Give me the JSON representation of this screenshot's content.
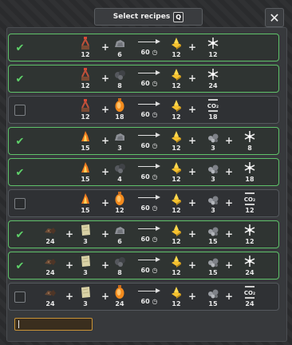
{
  "header": {
    "title": "Select recipes",
    "hotkey": "Q",
    "close_glyph": "✕"
  },
  "symbols": {
    "check": "✔",
    "plus": "+",
    "clock_glyph": "◷"
  },
  "search": {
    "value": ""
  },
  "recipes": [
    {
      "selected": true,
      "inputs": [
        {
          "icon": "crane-icon",
          "qty": "12"
        },
        {
          "icon": "stone-icon",
          "qty": "6"
        }
      ],
      "time": "60",
      "outputs": [
        {
          "icon": "gold-ingot-icon",
          "qty": "12"
        },
        {
          "icon": "snowflake-icon",
          "qty": "12"
        }
      ]
    },
    {
      "selected": true,
      "inputs": [
        {
          "icon": "crane-icon",
          "qty": "12"
        },
        {
          "icon": "coal-icon",
          "qty": "8"
        }
      ],
      "time": "60",
      "outputs": [
        {
          "icon": "gold-ingot-icon",
          "qty": "12"
        },
        {
          "icon": "snowflake-icon",
          "qty": "24"
        }
      ]
    },
    {
      "selected": false,
      "inputs": [
        {
          "icon": "crane-icon",
          "qty": "12"
        },
        {
          "icon": "gas-canister-icon",
          "qty": "18"
        }
      ],
      "time": "60",
      "outputs": [
        {
          "icon": "gold-ingot-icon",
          "qty": "12"
        },
        {
          "icon": "co2-icon",
          "qty": "18"
        }
      ]
    },
    {
      "selected": true,
      "inputs": [
        {
          "icon": "molten-metal-icon",
          "qty": "15"
        },
        {
          "icon": "stone-icon",
          "qty": "3"
        }
      ],
      "time": "60",
      "outputs": [
        {
          "icon": "gold-ingot-icon",
          "qty": "12"
        },
        {
          "icon": "gravel-icon",
          "qty": "3"
        },
        {
          "icon": "snowflake-icon",
          "qty": "8"
        }
      ]
    },
    {
      "selected": true,
      "inputs": [
        {
          "icon": "molten-metal-icon",
          "qty": "15"
        },
        {
          "icon": "coal-icon",
          "qty": "4"
        }
      ],
      "time": "60",
      "outputs": [
        {
          "icon": "gold-ingot-icon",
          "qty": "12"
        },
        {
          "icon": "gravel-icon",
          "qty": "3"
        },
        {
          "icon": "snowflake-icon",
          "qty": "18"
        }
      ]
    },
    {
      "selected": false,
      "inputs": [
        {
          "icon": "molten-metal-icon",
          "qty": "15"
        },
        {
          "icon": "gas-canister-icon",
          "qty": "12"
        }
      ],
      "time": "60",
      "outputs": [
        {
          "icon": "gold-ingot-icon",
          "qty": "12"
        },
        {
          "icon": "gravel-icon",
          "qty": "3"
        },
        {
          "icon": "co2-icon",
          "qty": "12"
        }
      ]
    },
    {
      "selected": true,
      "inputs": [
        {
          "icon": "ore-chunks-icon",
          "qty": "24"
        },
        {
          "icon": "limestone-icon",
          "qty": "3"
        },
        {
          "icon": "stone-icon",
          "qty": "6"
        }
      ],
      "time": "60",
      "outputs": [
        {
          "icon": "gold-ingot-icon",
          "qty": "12"
        },
        {
          "icon": "gravel-icon",
          "qty": "15"
        },
        {
          "icon": "snowflake-icon",
          "qty": "12"
        }
      ]
    },
    {
      "selected": true,
      "inputs": [
        {
          "icon": "ore-chunks-icon",
          "qty": "24"
        },
        {
          "icon": "limestone-icon",
          "qty": "3"
        },
        {
          "icon": "coal-icon",
          "qty": "8"
        }
      ],
      "time": "60",
      "outputs": [
        {
          "icon": "gold-ingot-icon",
          "qty": "12"
        },
        {
          "icon": "gravel-icon",
          "qty": "15"
        },
        {
          "icon": "snowflake-icon",
          "qty": "24"
        }
      ]
    },
    {
      "selected": false,
      "inputs": [
        {
          "icon": "ore-chunks-icon",
          "qty": "24"
        },
        {
          "icon": "limestone-icon",
          "qty": "3"
        },
        {
          "icon": "gas-canister-icon",
          "qty": "24"
        }
      ],
      "time": "60",
      "outputs": [
        {
          "icon": "gold-ingot-icon",
          "qty": "12"
        },
        {
          "icon": "gravel-icon",
          "qty": "15"
        },
        {
          "icon": "co2-icon",
          "qty": "24"
        }
      ]
    }
  ],
  "colors": {
    "selected_border": "#5fc26a",
    "unselected_border": "#55595e",
    "accent_gold": "#f3b52b"
  }
}
